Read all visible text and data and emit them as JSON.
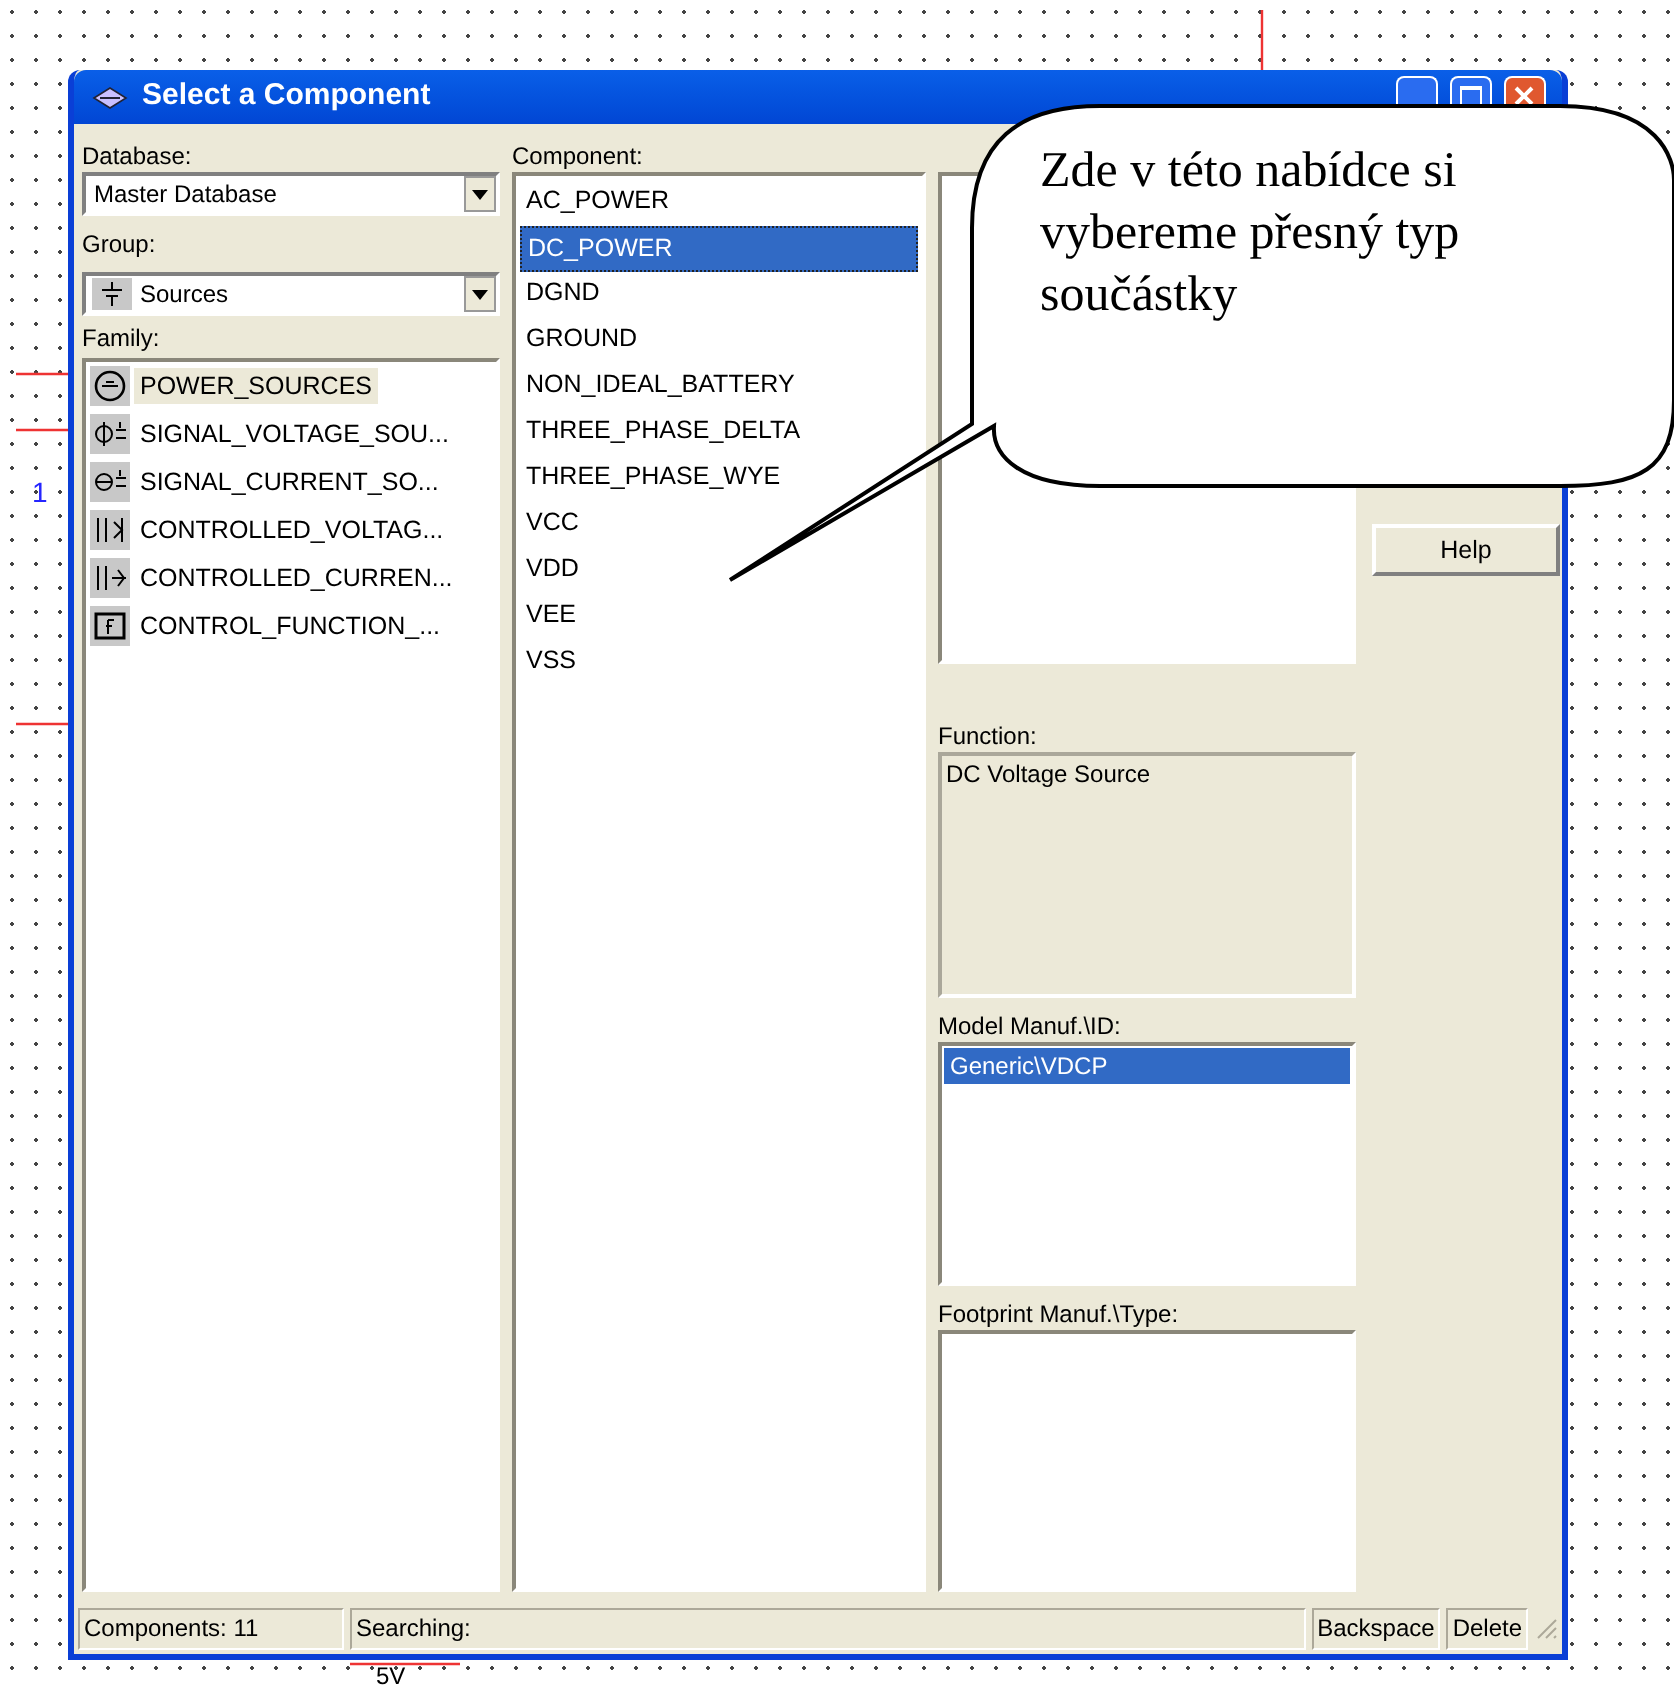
{
  "window": {
    "title": "Select a Component"
  },
  "database": {
    "label": "Database:",
    "value": "Master Database"
  },
  "group": {
    "label": "Group:",
    "value": "Sources"
  },
  "family": {
    "label": "Family:",
    "items": [
      {
        "label": "POWER_SOURCES",
        "selected": true
      },
      {
        "label": "SIGNAL_VOLTAGE_SOU...",
        "selected": false
      },
      {
        "label": "SIGNAL_CURRENT_SO...",
        "selected": false
      },
      {
        "label": "CONTROLLED_VOLTAG...",
        "selected": false
      },
      {
        "label": "CONTROLLED_CURREN...",
        "selected": false
      },
      {
        "label": "CONTROL_FUNCTION_...",
        "selected": false
      }
    ]
  },
  "component": {
    "label": "Component:",
    "items": [
      {
        "label": "AC_POWER",
        "selected": false
      },
      {
        "label": "DC_POWER",
        "selected": true
      },
      {
        "label": "DGND",
        "selected": false
      },
      {
        "label": "GROUND",
        "selected": false
      },
      {
        "label": "NON_IDEAL_BATTERY",
        "selected": false
      },
      {
        "label": "THREE_PHASE_DELTA",
        "selected": false
      },
      {
        "label": "THREE_PHASE_WYE",
        "selected": false
      },
      {
        "label": "VCC",
        "selected": false
      },
      {
        "label": "VDD",
        "selected": false
      },
      {
        "label": "VEE",
        "selected": false
      },
      {
        "label": "VSS",
        "selected": false
      }
    ]
  },
  "function": {
    "label": "Function:",
    "value": "DC Voltage Source"
  },
  "model": {
    "label": "Model Manuf.\\ID:",
    "items": [
      {
        "label": "Generic\\VDCP",
        "selected": true
      }
    ]
  },
  "footprint": {
    "label": "Footprint Manuf.\\Type:"
  },
  "buttons": [
    "Help"
  ],
  "status_bar": [
    "Components: 11",
    "Searching:",
    "Backspace",
    "Delete"
  ],
  "callout": {
    "text": "Zde v této nabídce si vybereme přesný typ součástky"
  },
  "schematic": {
    "labels": [
      "1",
      "5V"
    ]
  }
}
